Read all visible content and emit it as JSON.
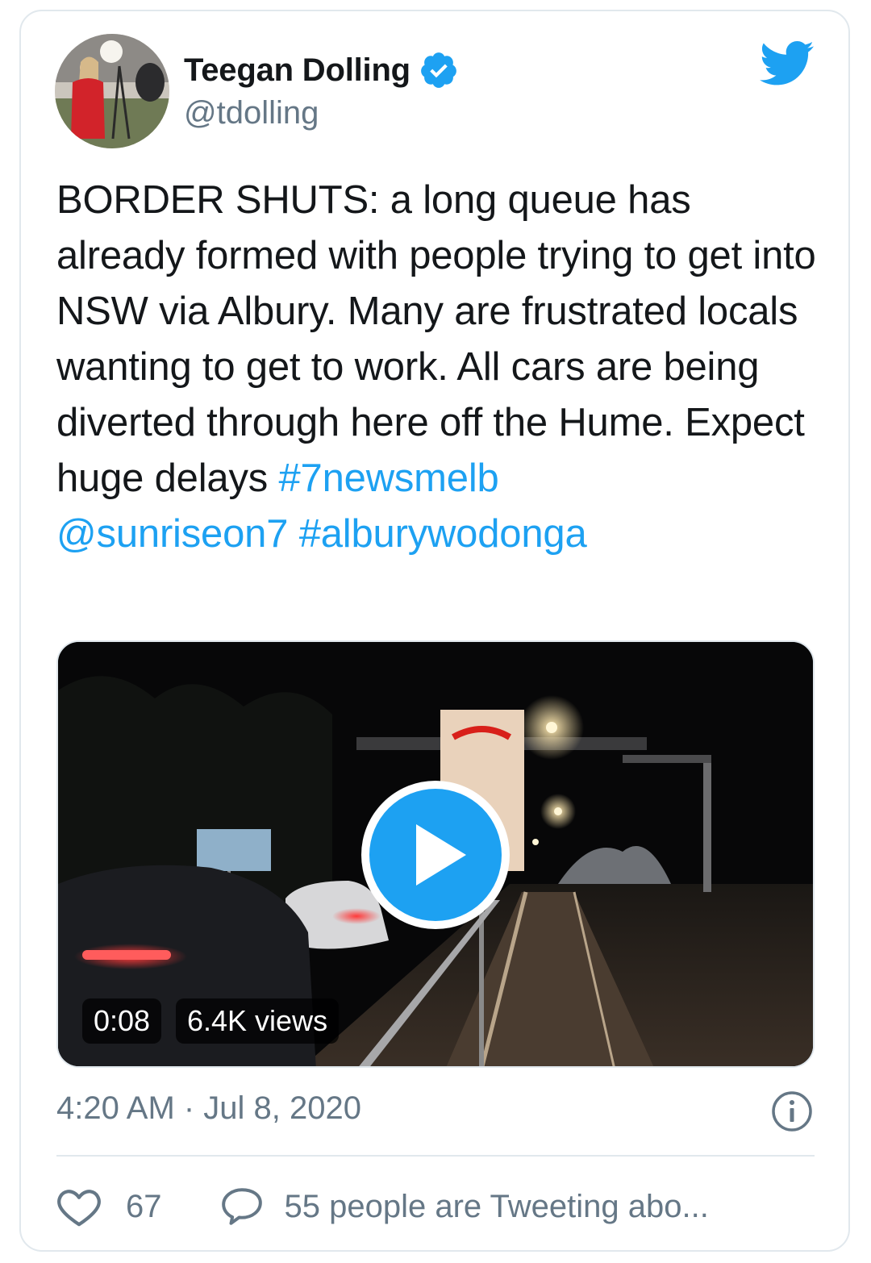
{
  "author": {
    "display_name": "Teegan Dolling",
    "handle": "@tdolling",
    "verified_icon": "verified-badge-icon",
    "avatar_icon": "profile-photo"
  },
  "brand": {
    "icon": "twitter-bird-icon",
    "color": "#1da1f2"
  },
  "tweet": {
    "text": "BORDER SHUTS: a long queue has already formed with people trying to get into NSW via Albury. Many are frustrated locals wanting to get to work. All cars are being diverted through here off the Hume. Expect huge delays ",
    "hashtag_1": "#7newsmelb",
    "mention": "@sunriseon7",
    "hashtag_2": "#alburywodonga"
  },
  "video": {
    "duration": "0:08",
    "views": "6.4K views",
    "play_icon": "play-icon"
  },
  "timestamp": "4:20 AM · Jul 8, 2020",
  "engagement": {
    "likes": "67",
    "discussion": "55 people are Tweeting abo..."
  },
  "colors": {
    "link": "#1da1f2",
    "secondary_text": "#657786",
    "border": "#e1e8ed"
  }
}
